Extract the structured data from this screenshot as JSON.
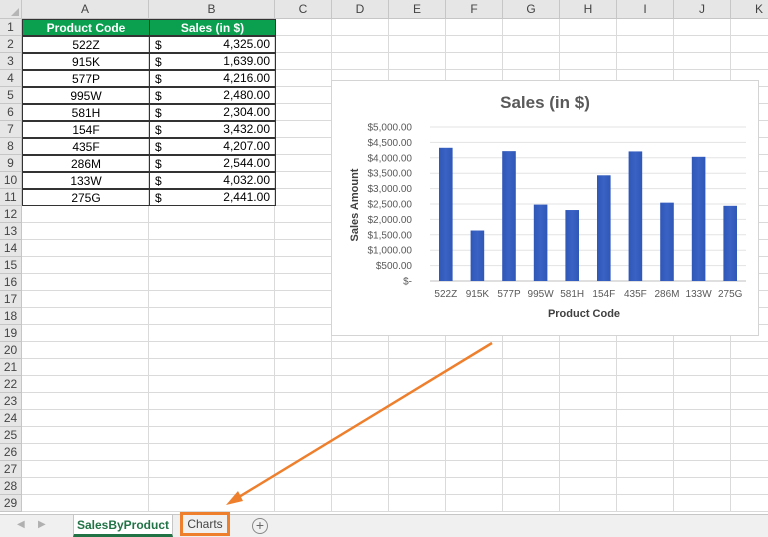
{
  "columns": [
    "A",
    "B",
    "C",
    "D",
    "E",
    "F",
    "G",
    "H",
    "I",
    "J",
    "K"
  ],
  "rows": [
    "1",
    "2",
    "3",
    "4",
    "5",
    "6",
    "7",
    "8",
    "9",
    "10",
    "11",
    "12",
    "13",
    "14",
    "15",
    "16",
    "17",
    "18",
    "19",
    "20",
    "21",
    "22",
    "23",
    "24",
    "25",
    "26",
    "27",
    "28",
    "29"
  ],
  "table": {
    "headers": [
      "Product Code",
      "Sales (in $)"
    ],
    "currency_symbol": "$",
    "rows": [
      {
        "code": "522Z",
        "amount": "4,325.00"
      },
      {
        "code": "915K",
        "amount": "1,639.00"
      },
      {
        "code": "577P",
        "amount": "4,216.00"
      },
      {
        "code": "995W",
        "amount": "2,480.00"
      },
      {
        "code": "581H",
        "amount": "2,304.00"
      },
      {
        "code": "154F",
        "amount": "3,432.00"
      },
      {
        "code": "435F",
        "amount": "4,207.00"
      },
      {
        "code": "286M",
        "amount": "2,544.00"
      },
      {
        "code": "133W",
        "amount": "4,032.00"
      },
      {
        "code": "275G",
        "amount": "2,441.00"
      }
    ]
  },
  "chart_data": {
    "type": "bar",
    "title": "Sales (in $)",
    "xlabel": "Product Code",
    "ylabel": "Sales Amount",
    "categories": [
      "522Z",
      "915K",
      "577P",
      "995W",
      "581H",
      "154F",
      "435F",
      "286M",
      "133W",
      "275G"
    ],
    "values": [
      4325,
      1639,
      4216,
      2480,
      2304,
      3432,
      4207,
      2544,
      4032,
      2441
    ],
    "ylim": [
      0,
      5000
    ],
    "yticks": [
      {
        "value": 5000,
        "label": "$5,000.00"
      },
      {
        "value": 4500,
        "label": "$4,500.00"
      },
      {
        "value": 4000,
        "label": "$4,000.00"
      },
      {
        "value": 3500,
        "label": "$3,500.00"
      },
      {
        "value": 3000,
        "label": "$3,000.00"
      },
      {
        "value": 2500,
        "label": "$2,500.00"
      },
      {
        "value": 2000,
        "label": "$2,000.00"
      },
      {
        "value": 1500,
        "label": "$1,500.00"
      },
      {
        "value": 1000,
        "label": "$1,000.00"
      },
      {
        "value": 500,
        "label": "$500.00"
      },
      {
        "value": 0,
        "label": "$-"
      }
    ],
    "grid": true,
    "legend": "none",
    "bar_color": "#3a62c4"
  },
  "sheet_tabs": [
    {
      "label": "SalesByProduct",
      "active": true
    },
    {
      "label": "Charts",
      "active": false
    }
  ],
  "add_sheet_symbol": "+",
  "nav": {
    "prev": "◀",
    "next": "▶"
  },
  "colors": {
    "header_fill": "#0aa050",
    "accent": "#217346",
    "annotation": "#ee7f2d"
  }
}
